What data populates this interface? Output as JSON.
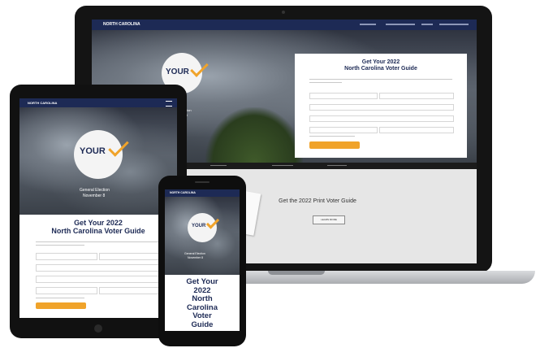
{
  "brand": {
    "nav_logo_text": "NORTH CAROLINA",
    "logo_word": "YOUR",
    "logo_small": "VOTE",
    "edition": "General Election",
    "edition_date": "November 8"
  },
  "laptop": {
    "nav_links": [
      "",
      "",
      "",
      ""
    ],
    "form_title_line1": "Get Your 2022",
    "form_title_line2": "North Carolina Voter Guide",
    "submit_label": "",
    "footer_links": [
      "",
      "",
      ""
    ],
    "print_title": "Get the 2022 Print Voter Guide",
    "print_button": "LEARN MORE"
  },
  "tablet": {
    "form_title_line1": "Get Your 2022",
    "form_title_line2": "North Carolina Voter Guide"
  },
  "phone": {
    "title_lines": [
      "Get Your",
      "2022",
      "North",
      "Carolina",
      "Voter",
      "Guide"
    ]
  },
  "colors": {
    "navy": "#1d2a55",
    "accent": "#f0a32a"
  }
}
